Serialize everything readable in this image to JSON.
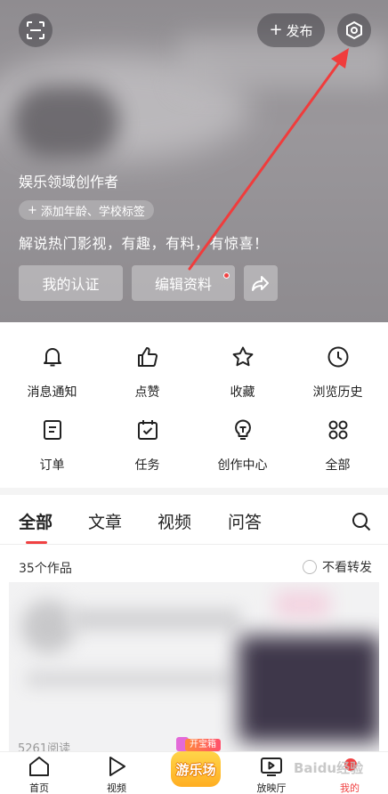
{
  "header": {
    "publish_label": "发布",
    "author_title": "娱乐领域创作者",
    "tag_chip_label": "添加年龄、学校标签",
    "bio": "解说热门影视，有趣，有料，有惊喜！",
    "cert_button": "我的认证",
    "edit_button": "编辑资料"
  },
  "menu": {
    "items": [
      {
        "label": "消息通知",
        "icon": "bell-icon"
      },
      {
        "label": "点赞",
        "icon": "thumbs-up-icon"
      },
      {
        "label": "收藏",
        "icon": "star-icon"
      },
      {
        "label": "浏览历史",
        "icon": "clock-icon"
      },
      {
        "label": "订单",
        "icon": "order-icon"
      },
      {
        "label": "任务",
        "icon": "calendar-check-icon"
      },
      {
        "label": "创作中心",
        "icon": "bulb-icon"
      },
      {
        "label": "全部",
        "icon": "grid-icon"
      }
    ]
  },
  "tabs": {
    "items": [
      "全部",
      "文章",
      "视频",
      "问答"
    ],
    "active": "全部"
  },
  "works": {
    "count_label": "35个作品",
    "hide_repost_label": "不看转发",
    "views_label": "5261阅读"
  },
  "bottom_nav": {
    "home": "首页",
    "video": "视频",
    "playground": "游乐场",
    "playground_ribbon": "开宝箱",
    "cinema": "放映厅",
    "mine": "我的"
  },
  "watermark": "Baidu经验",
  "colors": {
    "accent": "#f04142",
    "header_bg": "#8f8c90",
    "annotation_arrow": "#f03c3c"
  }
}
